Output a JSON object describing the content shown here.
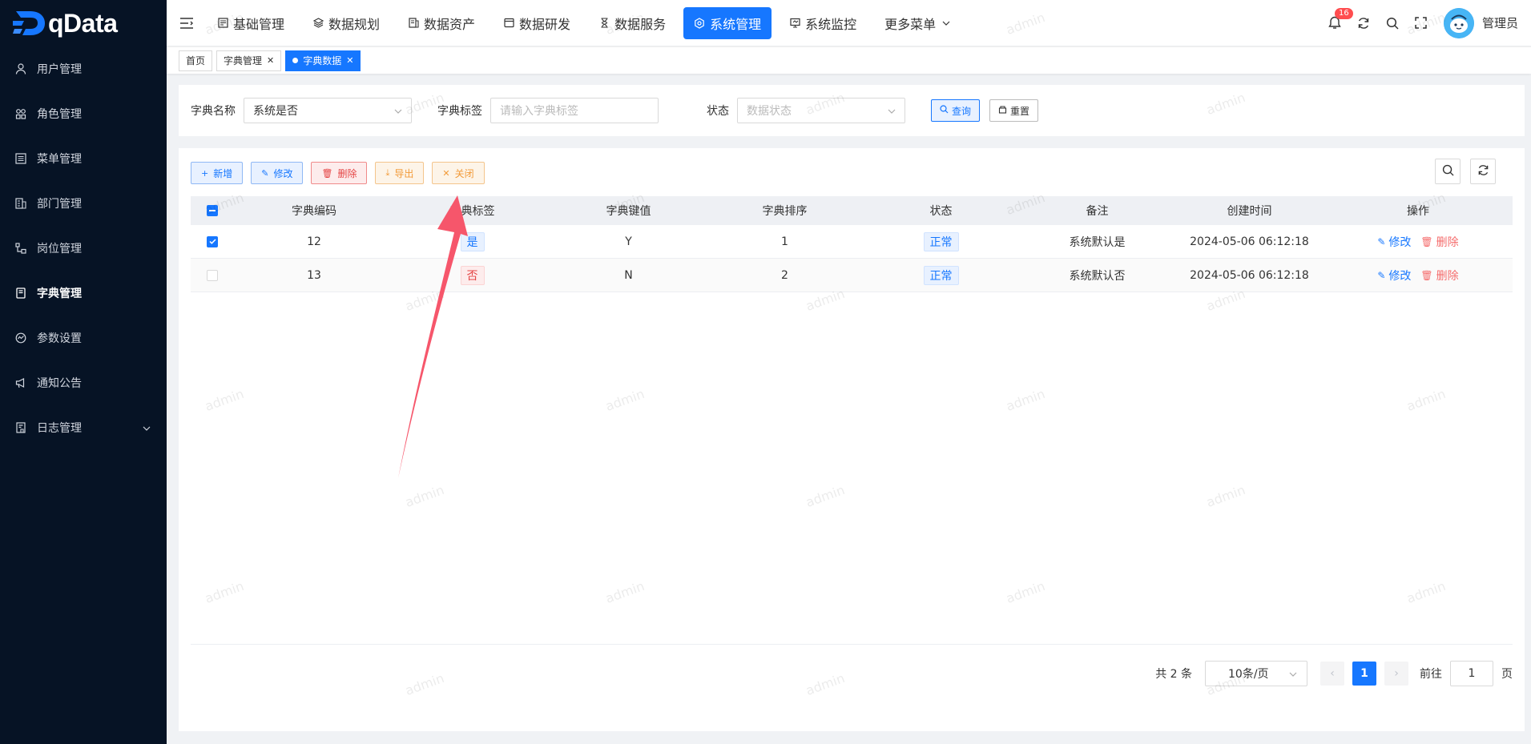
{
  "app": {
    "logo_text": "qData"
  },
  "sidebar": {
    "items": [
      {
        "label": "用户管理",
        "icon": "user-icon"
      },
      {
        "label": "角色管理",
        "icon": "roles-icon"
      },
      {
        "label": "菜单管理",
        "icon": "menu-icon"
      },
      {
        "label": "部门管理",
        "icon": "department-icon"
      },
      {
        "label": "岗位管理",
        "icon": "post-icon"
      },
      {
        "label": "字典管理",
        "icon": "dictionary-icon",
        "active": true
      },
      {
        "label": "参数设置",
        "icon": "params-icon"
      },
      {
        "label": "通知公告",
        "icon": "announcement-icon"
      },
      {
        "label": "日志管理",
        "icon": "log-icon",
        "expandable": true
      }
    ]
  },
  "topnav": {
    "items": [
      {
        "label": "基础管理"
      },
      {
        "label": "数据规划"
      },
      {
        "label": "数据资产"
      },
      {
        "label": "数据研发"
      },
      {
        "label": "数据服务"
      },
      {
        "label": "系统管理",
        "active": true
      },
      {
        "label": "系统监控"
      },
      {
        "label": "更多菜单"
      }
    ],
    "notification_count": "16",
    "username": "管理员"
  },
  "tabs": [
    {
      "label": "首页"
    },
    {
      "label": "字典管理"
    },
    {
      "label": "字典数据",
      "active": true
    }
  ],
  "search": {
    "dict_name_label": "字典名称",
    "dict_name_value": "系统是否",
    "dict_label_label": "字典标签",
    "dict_label_placeholder": "请输入字典标签",
    "status_label": "状态",
    "status_placeholder": "数据状态",
    "query_label": "查询",
    "reset_label": "重置"
  },
  "toolbar": {
    "add_label": "新增",
    "edit_label": "修改",
    "delete_label": "删除",
    "export_label": "导出",
    "close_label": "关闭"
  },
  "table": {
    "headers": [
      "字典编码",
      "字典标签",
      "字典键值",
      "字典排序",
      "状态",
      "备注",
      "创建时间",
      "操作"
    ],
    "rows": [
      {
        "checked": true,
        "code": "12",
        "label": "是",
        "label_color": "blue",
        "value": "Y",
        "sort": "1",
        "status": "正常",
        "remark": "系统默认是",
        "created": "2024-05-06 06:12:18",
        "edit": "修改",
        "del": "删除"
      },
      {
        "checked": false,
        "code": "13",
        "label": "否",
        "label_color": "red",
        "value": "N",
        "sort": "2",
        "status": "正常",
        "remark": "系统默认否",
        "created": "2024-05-06 06:12:18",
        "edit": "修改",
        "del": "删除"
      }
    ]
  },
  "pagination": {
    "total_text": "共 2 条",
    "page_size": "10条/页",
    "current_page": "1",
    "goto_label": "前往",
    "goto_value": "1",
    "page_suffix": "页"
  },
  "watermark_text": "admin",
  "colors": {
    "primary": "#1677ff",
    "sidebar_bg": "#061325",
    "danger": "#e54545",
    "warning": "#f29a38",
    "annotation_arrow": "#f6566b"
  }
}
